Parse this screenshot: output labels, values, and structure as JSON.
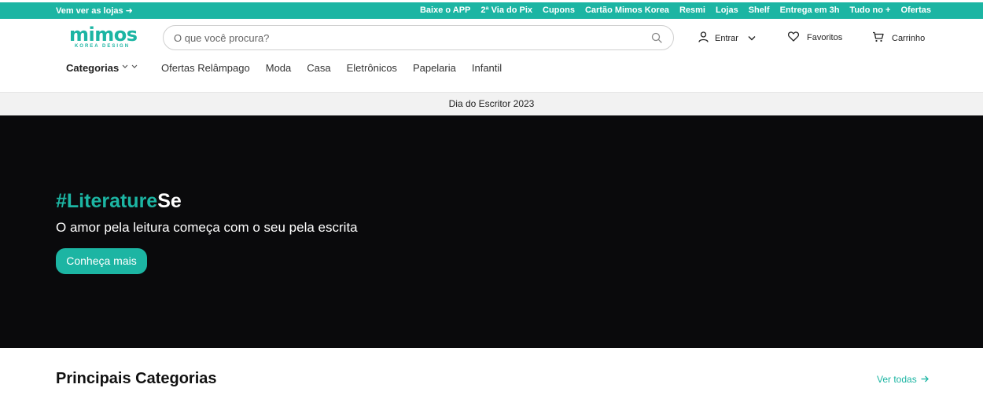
{
  "topbar": {
    "left_link": "Vem ver as lojas ➜",
    "links": [
      "Baixe o APP",
      "2ª Via do Pix",
      "Cupons",
      "Cartão Mimos Korea",
      "Resmi",
      "Lojas",
      "Shelf",
      "Entrega em 3h",
      "Tudo no +",
      "Ofertas"
    ]
  },
  "header": {
    "logo": {
      "main": "mimos",
      "sub": "KOREA DESIGN"
    },
    "search": {
      "placeholder": "O que você procura?"
    },
    "account_label": "Entrar",
    "favorites_label": "Favoritos",
    "cart_label": "Carrinho"
  },
  "nav": {
    "categories_label": "Categorias",
    "items": [
      "Ofertas Relâmpago",
      "Moda",
      "Casa",
      "Eletrônicos",
      "Papelaria",
      "Infantil"
    ]
  },
  "announcement": "Dia do Escritor 2023",
  "hero": {
    "headline_accent": "#Literature",
    "headline_rest": "Se",
    "subtitle": "O amor pela leitura começa com o seu pela escrita",
    "cta_label": "Conheça mais"
  },
  "section": {
    "title": "Principais Categorias",
    "see_all": "Ver todas"
  },
  "icons": {
    "search": "search-icon",
    "user": "user-icon",
    "chevron": "chevron-down-icon",
    "heart": "heart-icon",
    "cart": "cart-icon",
    "arrow": "arrow-right-icon"
  },
  "colors": {
    "brand": "#1cb5a3",
    "hero_bg": "#0a0a0c",
    "announcement_bg": "#f2f2f2"
  }
}
